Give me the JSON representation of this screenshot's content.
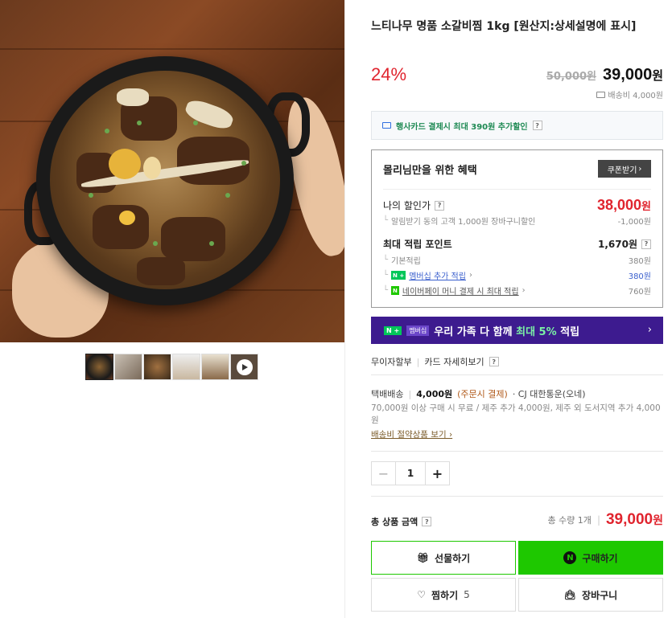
{
  "product": {
    "title": "느티나무 명품 소갈비찜 1kg [원산지:상세설명에 표시]",
    "discount_rate": "24%",
    "original_price": "50,000원",
    "sale_price": "39,000",
    "sale_unit": "원",
    "shipping_fee": "배송비 4,000원"
  },
  "card_promo": {
    "text": "행사카드 결제시 최대 390원 추가할인",
    "help": "?"
  },
  "benefit": {
    "heading": "몰리님만을 위한 혜택",
    "coupon_button": "쿠폰받기",
    "my_price_label": "나의 할인가",
    "my_price": "38,000",
    "my_price_unit": "원",
    "alarm_label": "알림받기 동의 고객 1,000원 장바구니할인",
    "alarm_value": "-1,000원",
    "points_label": "최대 적립 포인트",
    "points_value": "1,670원",
    "basic_label": "기본적립",
    "basic_value": "380원",
    "membership_label": "멤버십 추가 적립",
    "membership_value": "380원",
    "npay_label": "네이버페이 머니 결제 시 최대 적립",
    "npay_value": "760원",
    "badge_n": "N +",
    "badge_n2": "N"
  },
  "promo_banner": {
    "badge1": "N +",
    "badge2": "멤버십",
    "text_before": "우리 가족 다 함께 ",
    "text_highlight": "최대 5%",
    "text_after": " 적립",
    "arrow": "›"
  },
  "installment": {
    "label": "무이자할부",
    "detail": "카드 자세히보기"
  },
  "shipping": {
    "type": "택배배송",
    "price": "4,000원",
    "condition": "(주문시 결제)",
    "carrier": "· CJ 대한통운(오네)",
    "note": "70,000원 이상 구매 시 무료 / 제주 추가 4,000원, 제주 외 도서지역 추가 4,000원",
    "link": "배송비 절약상품 보기 ›"
  },
  "quantity": {
    "minus": "−",
    "value": "1",
    "plus": "+"
  },
  "total": {
    "label": "총 상품 금액",
    "qty_text": "총 수량 1개",
    "price": "39,000",
    "unit": "원"
  },
  "buttons": {
    "gift": "선물하기",
    "buy": "구매하기",
    "wish": "찜하기",
    "wish_count": "5",
    "cart": "장바구니"
  },
  "colors": {
    "accent_red": "#e0242e",
    "naver_green": "#1ec800",
    "promo_purple": "#3d1b8f"
  },
  "thumbnails": [
    "thumb-1",
    "thumb-2",
    "thumb-3",
    "thumb-4",
    "thumb-5",
    "thumb-video"
  ]
}
